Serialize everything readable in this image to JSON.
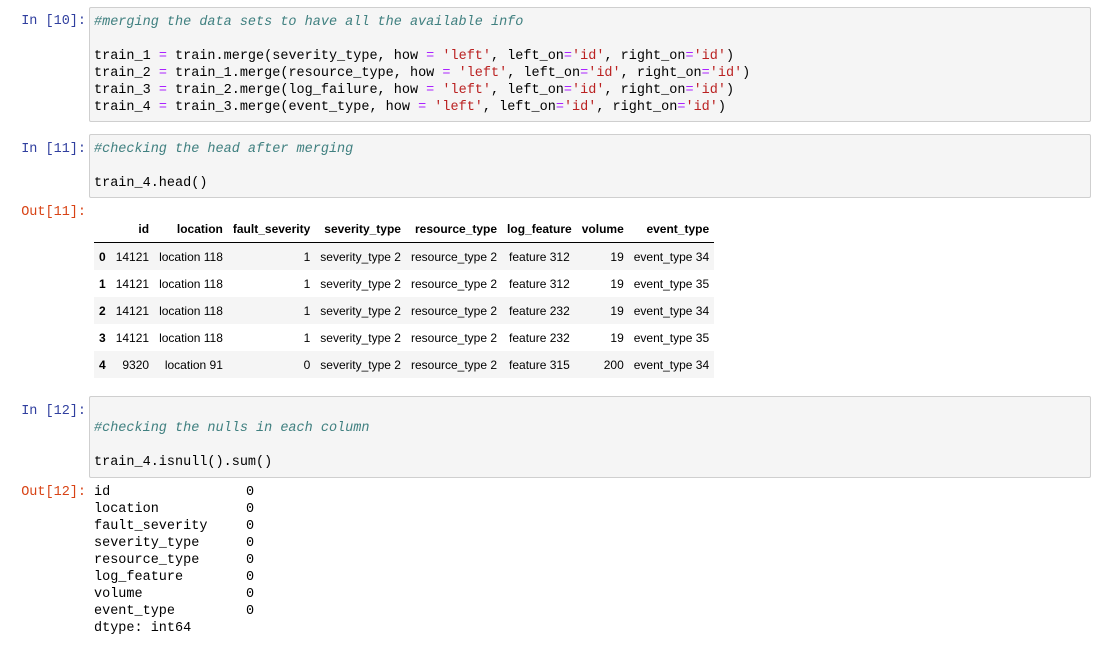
{
  "cells": [
    {
      "prompt": "In [10]:",
      "lines": [
        [
          {
            "t": "c",
            "v": "#merging the data sets to have all the available info"
          }
        ],
        [],
        [
          {
            "t": "n",
            "v": "train_1 "
          },
          {
            "t": "o",
            "v": "="
          },
          {
            "t": "n",
            "v": " train.merge(severity_type, how "
          },
          {
            "t": "o",
            "v": "="
          },
          {
            "t": "n",
            "v": " "
          },
          {
            "t": "s",
            "v": "'left'"
          },
          {
            "t": "n",
            "v": ", left_on"
          },
          {
            "t": "o",
            "v": "="
          },
          {
            "t": "s",
            "v": "'id'"
          },
          {
            "t": "n",
            "v": ", right_on"
          },
          {
            "t": "o",
            "v": "="
          },
          {
            "t": "s",
            "v": "'id'"
          },
          {
            "t": "n",
            "v": ")"
          }
        ],
        [
          {
            "t": "n",
            "v": "train_2 "
          },
          {
            "t": "o",
            "v": "="
          },
          {
            "t": "n",
            "v": " train_1.merge(resource_type, how "
          },
          {
            "t": "o",
            "v": "="
          },
          {
            "t": "n",
            "v": " "
          },
          {
            "t": "s",
            "v": "'left'"
          },
          {
            "t": "n",
            "v": ", left_on"
          },
          {
            "t": "o",
            "v": "="
          },
          {
            "t": "s",
            "v": "'id'"
          },
          {
            "t": "n",
            "v": ", right_on"
          },
          {
            "t": "o",
            "v": "="
          },
          {
            "t": "s",
            "v": "'id'"
          },
          {
            "t": "n",
            "v": ")"
          }
        ],
        [
          {
            "t": "n",
            "v": "train_3 "
          },
          {
            "t": "o",
            "v": "="
          },
          {
            "t": "n",
            "v": " train_2.merge(log_failure, how "
          },
          {
            "t": "o",
            "v": "="
          },
          {
            "t": "n",
            "v": " "
          },
          {
            "t": "s",
            "v": "'left'"
          },
          {
            "t": "n",
            "v": ", left_on"
          },
          {
            "t": "o",
            "v": "="
          },
          {
            "t": "s",
            "v": "'id'"
          },
          {
            "t": "n",
            "v": ", right_on"
          },
          {
            "t": "o",
            "v": "="
          },
          {
            "t": "s",
            "v": "'id'"
          },
          {
            "t": "n",
            "v": ")"
          }
        ],
        [
          {
            "t": "n",
            "v": "train_4 "
          },
          {
            "t": "o",
            "v": "="
          },
          {
            "t": "n",
            "v": " train_3.merge(event_type, how "
          },
          {
            "t": "o",
            "v": "="
          },
          {
            "t": "n",
            "v": " "
          },
          {
            "t": "s",
            "v": "'left'"
          },
          {
            "t": "n",
            "v": ", left_on"
          },
          {
            "t": "o",
            "v": "="
          },
          {
            "t": "s",
            "v": "'id'"
          },
          {
            "t": "n",
            "v": ", right_on"
          },
          {
            "t": "o",
            "v": "="
          },
          {
            "t": "s",
            "v": "'id'"
          },
          {
            "t": "n",
            "v": ")"
          }
        ]
      ]
    },
    {
      "prompt": "In [11]:",
      "lines": [
        [
          {
            "t": "c",
            "v": "#checking the head after merging"
          }
        ],
        [],
        [
          {
            "t": "n",
            "v": "train_4.head()"
          }
        ]
      ]
    },
    {
      "prompt": "In [12]:",
      "lines": [
        [],
        [
          {
            "t": "c",
            "v": "#checking the nulls in each column"
          }
        ],
        [],
        [
          {
            "t": "n",
            "v": "train_4.isnull().sum()"
          }
        ]
      ]
    }
  ],
  "out11": {
    "prompt": "Out[11]:",
    "columns": [
      "",
      "id",
      "location",
      "fault_severity",
      "severity_type",
      "resource_type",
      "log_feature",
      "volume",
      "event_type"
    ],
    "rows": [
      [
        "0",
        "14121",
        "location 118",
        "1",
        "severity_type 2",
        "resource_type 2",
        "feature 312",
        "19",
        "event_type 34"
      ],
      [
        "1",
        "14121",
        "location 118",
        "1",
        "severity_type 2",
        "resource_type 2",
        "feature 312",
        "19",
        "event_type 35"
      ],
      [
        "2",
        "14121",
        "location 118",
        "1",
        "severity_type 2",
        "resource_type 2",
        "feature 232",
        "19",
        "event_type 34"
      ],
      [
        "3",
        "14121",
        "location 118",
        "1",
        "severity_type 2",
        "resource_type 2",
        "feature 232",
        "19",
        "event_type 35"
      ],
      [
        "4",
        "9320",
        "location 91",
        "0",
        "severity_type 2",
        "resource_type 2",
        "feature 315",
        "200",
        "event_type 34"
      ]
    ]
  },
  "out12": {
    "prompt": "Out[12]:",
    "rows": [
      [
        "id",
        "0"
      ],
      [
        "location",
        "0"
      ],
      [
        "fault_severity",
        "0"
      ],
      [
        "severity_type",
        "0"
      ],
      [
        "resource_type",
        "0"
      ],
      [
        "log_feature",
        "0"
      ],
      [
        "volume",
        "0"
      ],
      [
        "event_type",
        "0"
      ]
    ],
    "dtype": "dtype: int64"
  }
}
